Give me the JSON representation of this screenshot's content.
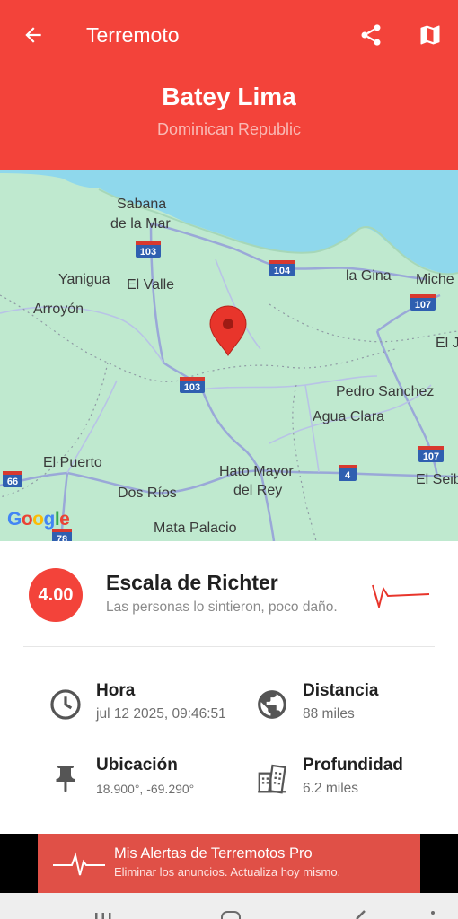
{
  "header": {
    "title": "Terremoto",
    "place": "Batey Lima",
    "country": "Dominican Republic",
    "color": "#f3433a",
    "icons": {
      "back": "arrow-left-icon",
      "share": "share-icon",
      "map": "map-icon"
    }
  },
  "map": {
    "labels": {
      "sabana": "Sabana",
      "de_la_mar": "de la Mar",
      "yanigua": "Yanigua",
      "el_valle": "El Valle",
      "arroyon": "Arroyón",
      "la_gina": "la Gina",
      "miche": "Miche",
      "el_j": "El J",
      "pedro_sanchez": "Pedro Sanchez",
      "agua_clara": "Agua Clara",
      "el_puerto": "El Puerto",
      "hato_mayor": "Hato Mayor",
      "del_rey": "del Rey",
      "dos_rios": "Dos Ríos",
      "el_seib": "El Seib",
      "mata_palacio": "Mata Palacio"
    },
    "shields": {
      "r103a": "103",
      "r104": "104",
      "r107a": "107",
      "r103b": "103",
      "r66": "66",
      "r4": "4",
      "r107b": "107",
      "r78": "78"
    },
    "attribution": "Google"
  },
  "event": {
    "magnitude": "4.00",
    "scale_title": "Escala de Richter",
    "scale_desc": "Las personas lo sintieron, poco daño."
  },
  "details": {
    "hora": {
      "label": "Hora",
      "value": "jul 12 2025, 09:46:51",
      "icon": "clock-icon"
    },
    "distancia": {
      "label": "Distancia",
      "value": "88 miles",
      "icon": "globe-icon"
    },
    "ubicacion": {
      "label": "Ubicación",
      "value": "18.900°, -69.290°",
      "icon": "pin-icon"
    },
    "profundidad": {
      "label": "Profundidad",
      "value": "6.2 miles",
      "icon": "buildings-icon"
    }
  },
  "ad": {
    "title": "Mis Alertas de Terremotos Pro",
    "subtitle": "Eliminar los anuncios. Actualiza hoy mismo.",
    "color": "#e05047"
  }
}
